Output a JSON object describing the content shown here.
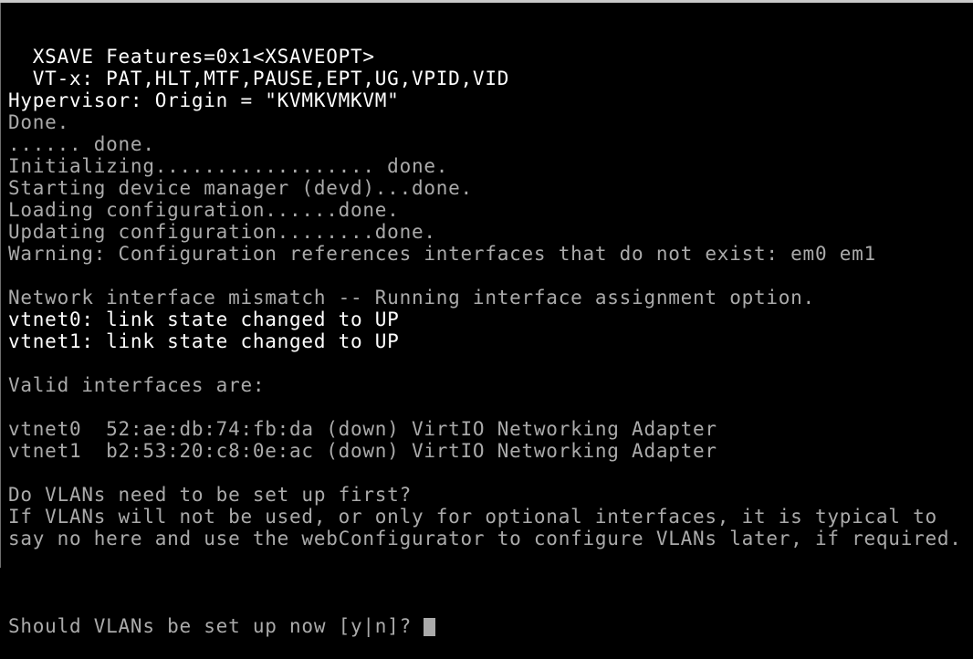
{
  "console": {
    "lines": [
      {
        "text": "  XSAVE Features=0x1<XSAVEOPT>",
        "style": "bright"
      },
      {
        "text": "  VT-x: PAT,HLT,MTF,PAUSE,EPT,UG,VPID,VID",
        "style": "bright"
      },
      {
        "text": "Hypervisor: Origin = \"KVMKVMKVM\"",
        "style": "bright"
      },
      {
        "text": "Done.",
        "style": "normal"
      },
      {
        "text": "...... done.",
        "style": "normal"
      },
      {
        "text": "Initializing.................. done.",
        "style": "normal"
      },
      {
        "text": "Starting device manager (devd)...done.",
        "style": "normal"
      },
      {
        "text": "Loading configuration......done.",
        "style": "normal"
      },
      {
        "text": "Updating configuration........done.",
        "style": "normal"
      },
      {
        "text": "Warning: Configuration references interfaces that do not exist: em0 em1",
        "style": "normal"
      },
      {
        "text": "",
        "style": "normal"
      },
      {
        "text": "Network interface mismatch -- Running interface assignment option.",
        "style": "normal"
      },
      {
        "text": "vtnet0: link state changed to UP",
        "style": "bright"
      },
      {
        "text": "vtnet1: link state changed to UP",
        "style": "bright"
      },
      {
        "text": "",
        "style": "normal"
      },
      {
        "text": "Valid interfaces are:",
        "style": "normal"
      },
      {
        "text": "",
        "style": "normal"
      },
      {
        "text": "vtnet0  52:ae:db:74:fb:da (down) VirtIO Networking Adapter",
        "style": "normal"
      },
      {
        "text": "vtnet1  b2:53:20:c8:0e:ac (down) VirtIO Networking Adapter",
        "style": "normal"
      },
      {
        "text": "",
        "style": "normal"
      },
      {
        "text": "Do VLANs need to be set up first?",
        "style": "normal"
      },
      {
        "text": "If VLANs will not be used, or only for optional interfaces, it is typical to",
        "style": "normal"
      },
      {
        "text": "say no here and use the webConfigurator to configure VLANs later, if required.",
        "style": "normal"
      },
      {
        "text": "",
        "style": "normal"
      }
    ],
    "prompt": {
      "text": "Should VLANs be set up now [y|n]? ",
      "input_value": ""
    },
    "colors": {
      "background": "#000000",
      "normal_text": "#aaaaaa",
      "bright_text": "#ffffff",
      "cursor": "#aaaaaa"
    }
  }
}
